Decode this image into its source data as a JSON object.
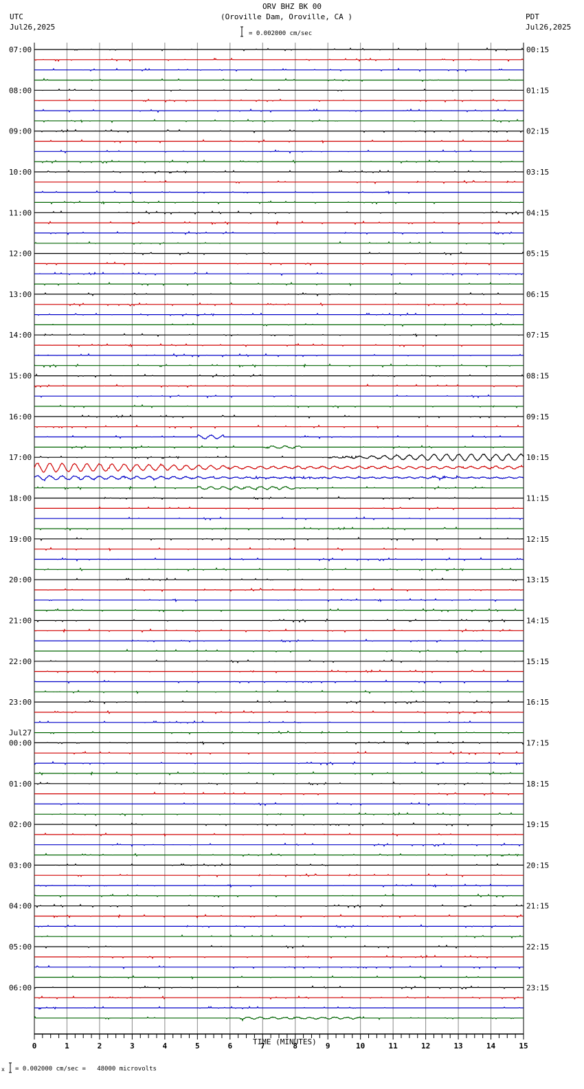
{
  "header": {
    "title": "ORV BHZ BK 00",
    "location": "(Oroville Dam, Oroville, CA )",
    "left_tz": "UTC",
    "left_date": "Jul26,2025",
    "right_tz": "PDT",
    "right_date": "Jul26,2025",
    "scale_text": "= 0.002000 cm/sec"
  },
  "footer": {
    "prefix": "x",
    "scale_text": "= 0.002000 cm/sec =   48000 microvolts"
  },
  "chart_data": {
    "type": "line",
    "title": "ORV BHZ BK 00",
    "xlabel": "TIME (MINUTES)",
    "xlim": [
      0,
      15
    ],
    "x_ticks": [
      "0",
      "1",
      "2",
      "3",
      "4",
      "5",
      "6",
      "7",
      "8",
      "9",
      "10",
      "11",
      "12",
      "13",
      "14",
      "15"
    ],
    "rows": 96,
    "minutes_per_row": 15,
    "trace_colors": [
      "#000000",
      "#d00000",
      "#0000c8",
      "#006400"
    ],
    "left_labels": [
      "07:00",
      "08:00",
      "09:00",
      "10:00",
      "11:00",
      "12:00",
      "13:00",
      "14:00",
      "15:00",
      "16:00",
      "17:00",
      "18:00",
      "19:00",
      "20:00",
      "21:00",
      "22:00",
      "23:00",
      "00:00",
      "01:00",
      "02:00",
      "03:00",
      "04:00",
      "05:00",
      "06:00"
    ],
    "date_change_label": "Jul27",
    "right_labels": [
      "00:15",
      "01:15",
      "02:15",
      "03:15",
      "04:15",
      "05:15",
      "06:15",
      "07:15",
      "08:15",
      "09:15",
      "10:15",
      "11:15",
      "12:15",
      "13:15",
      "14:15",
      "15:15",
      "16:15",
      "17:15",
      "18:15",
      "19:15",
      "20:15",
      "21:15",
      "22:15",
      "23:15"
    ],
    "events": [
      {
        "row": 38,
        "start_min": 5.0,
        "end_min": 5.8,
        "amplitude": 0.35
      },
      {
        "row": 39,
        "start_min": 7.0,
        "end_min": 8.2,
        "amplitude": 0.2
      },
      {
        "row": 40,
        "start_min": 9.0,
        "end_min": 15,
        "amplitude": 0.6,
        "grow": true
      },
      {
        "row": 41,
        "start_min": 0,
        "end_min": 15,
        "amplitude": 0.9,
        "decay": true
      },
      {
        "row": 42,
        "start_min": 0,
        "end_min": 15,
        "amplitude": 0.4,
        "decay": true
      },
      {
        "row": 43,
        "start_min": 5.0,
        "end_min": 8.0,
        "amplitude": 0.25
      },
      {
        "row": 95,
        "start_min": 6.3,
        "end_min": 10.0,
        "amplitude": 0.15
      }
    ]
  }
}
